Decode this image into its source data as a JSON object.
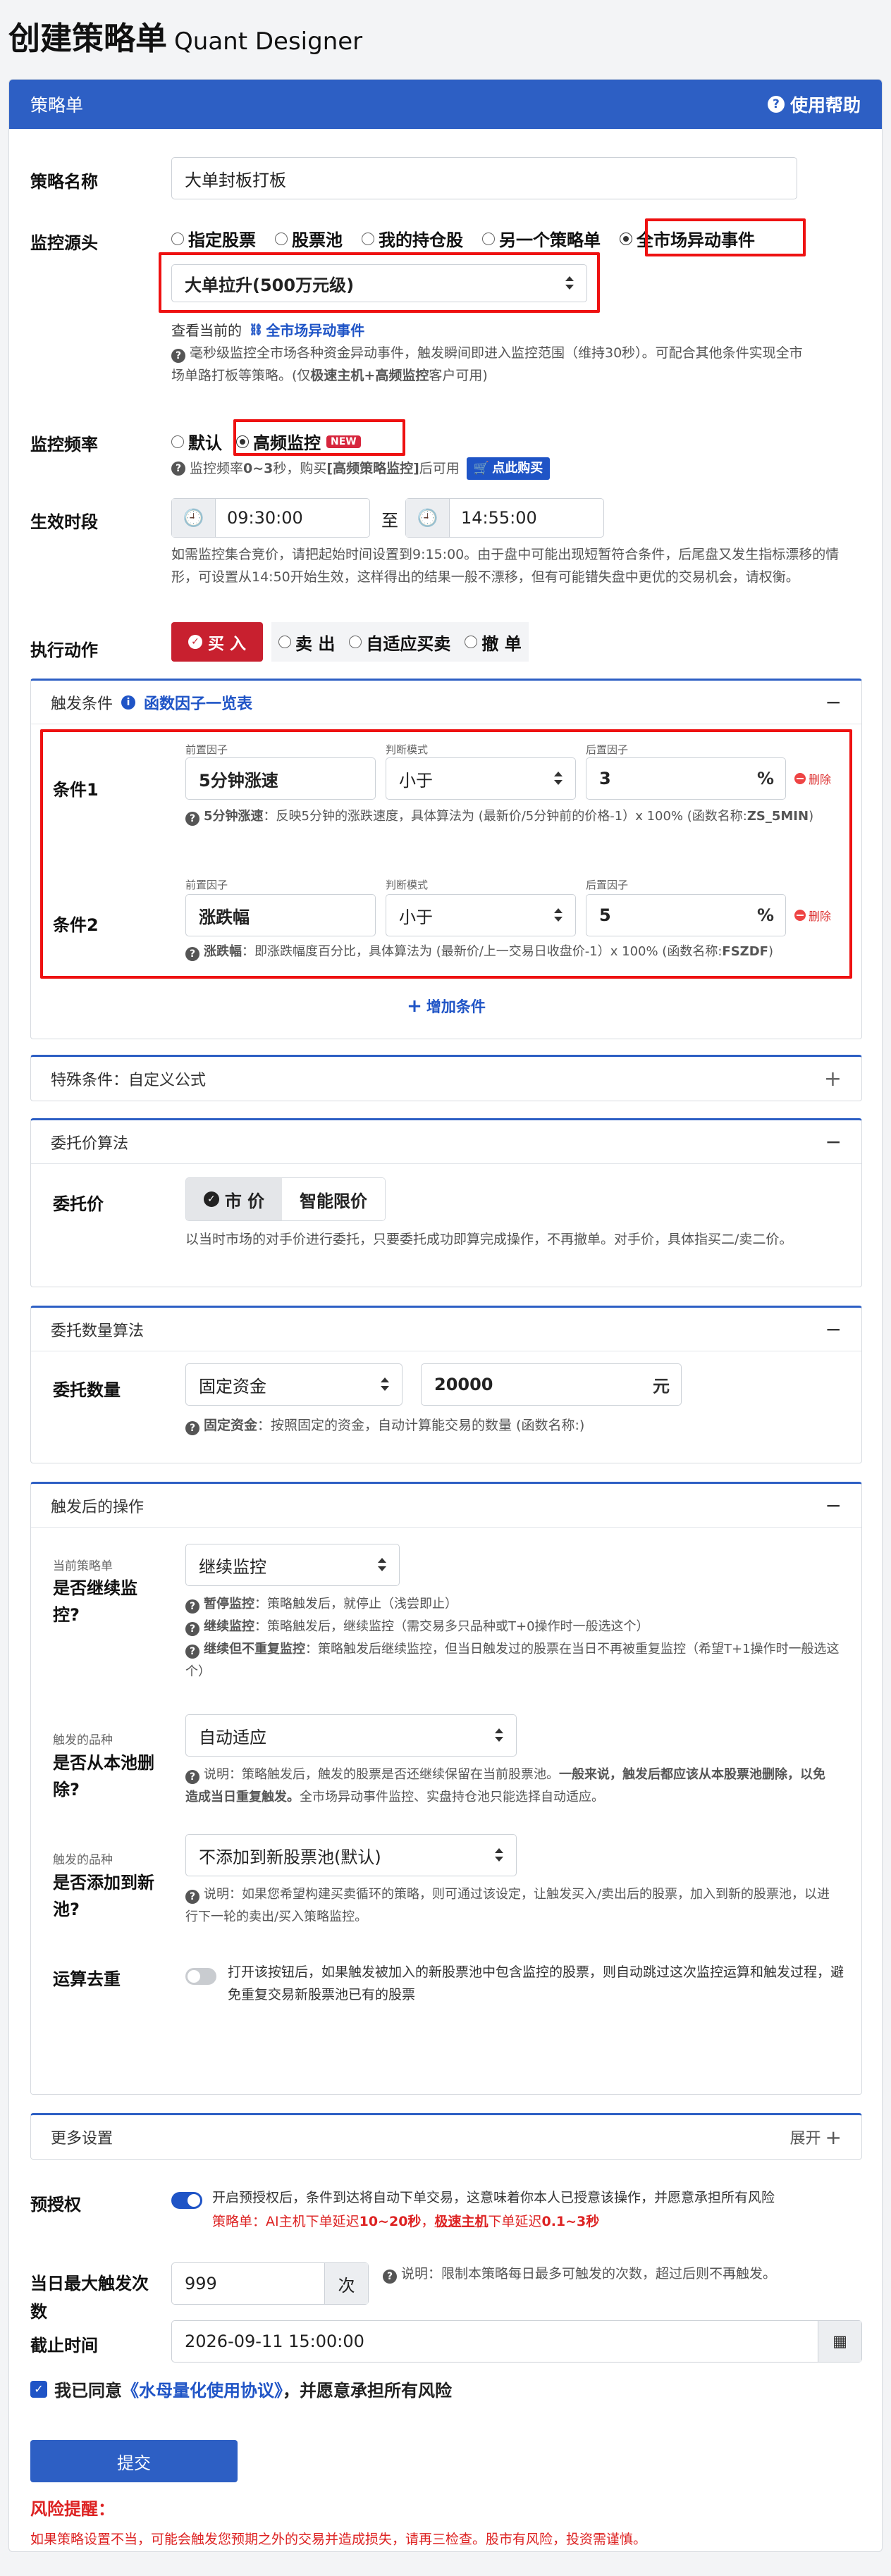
{
  "page": {
    "title": "创建策略单",
    "subtitle": "Quant Designer"
  },
  "card": {
    "title": "策略单",
    "help": "使用帮助"
  },
  "name_field": {
    "label": "策略名称",
    "value": "大单封板打板"
  },
  "source": {
    "label": "监控源头",
    "options": [
      "指定股票",
      "股票池",
      "我的持仓股",
      "另一个策略单",
      "全市场异动事件"
    ],
    "selected": "全市场异动事件",
    "event_select": "大单拉升(500万元级)",
    "view_current": "查看当前的",
    "event_link": "全市场异动事件",
    "note1": "毫秒级监控全市场各种资金异动事件，触发瞬间即进入监控范围（维持30秒）。可配合其他条件实现全市",
    "note2": "场单路打板等策略。(仅",
    "note2_bold": "极速主机+高频监控",
    "note2_tail": "客户可用)"
  },
  "freq": {
    "label": "监控频率",
    "opt_default": "默认",
    "opt_high": "高频监控",
    "badge": "NEW",
    "note_a": "监控频率 ",
    "note_b": "0~3",
    "note_c": " 秒，购买",
    "note_d": "[高频策略监控]",
    "note_e": "后可用",
    "buy_btn": "点此购买"
  },
  "time": {
    "label": "生效时段",
    "start": "09:30:00",
    "sep": "至",
    "end": "14:55:00",
    "note": "如需监控集合竞价，请把起始时间设置到9:15:00。由于盘中可能出现短暂符合条件，后尾盘又发生指标漂移的情形，可设置从14:50开始生效，这样得出的结果一般不漂移，但有可能错失盘中更优的交易机会，请权衡。"
  },
  "action": {
    "label": "执行动作",
    "buy": "买 入",
    "sell": "卖 出",
    "adaptive": "自适应买卖",
    "cancel": "撤 单"
  },
  "trigger": {
    "title": "触发条件",
    "link": "函数因子一览表",
    "collapse": "−",
    "pre_label": "前置因子",
    "mode_label": "判断模式",
    "post_label": "后置因子",
    "conditions": [
      {
        "name": "条件1",
        "factor": "5分钟涨速",
        "mode": "小于",
        "value": "3",
        "unit": "%",
        "delete": "删除",
        "note_bold": "5分钟涨速",
        "note": "：反映5分钟的涨跌速度，具体算法为 (最新价/5分钟前的价格-1）x 100% (函数名称:",
        "note_code": "ZS_5MIN",
        "note_end": ")"
      },
      {
        "name": "条件2",
        "factor": "涨跌幅",
        "mode": "小于",
        "value": "5",
        "unit": "%",
        "delete": "删除",
        "note_bold": "涨跌幅",
        "note": "：即涨跌幅度百分比，具体算法为 (最新价/上一交易日收盘价-1）x 100% (函数名称:",
        "note_code": "FSZDF",
        "note_end": ")"
      }
    ],
    "add": "增加条件"
  },
  "special": {
    "title": "特殊条件：自定义公式",
    "expand": "+"
  },
  "price_algo": {
    "title": "委托价算法",
    "collapse": "−",
    "label": "委托价",
    "opt_market": "市 价",
    "opt_smart": "智能限价",
    "note": "以当时市场的对手价进行委托，只要委托成功即算完成操作，不再撤单。对手价，具体指买二/卖二价。"
  },
  "qty_algo": {
    "title": "委托数量算法",
    "collapse": "−",
    "label": "委托数量",
    "mode": "固定资金",
    "amount": "20000",
    "unit": "元",
    "note_bold": "固定资金",
    "note": "：按照固定的资金，自动计算能交易的数量 (函数名称:)"
  },
  "after": {
    "title": "触发后的操作",
    "collapse": "−",
    "continue": {
      "small": "当前策略单",
      "label": "是否继续监控?",
      "value": "继续监控",
      "n1b": "暂停监控",
      "n1": "：策略触发后，就停止（浅尝即止）",
      "n2b": "继续监控",
      "n2": "：策略触发后，继续监控（需交易多只品种或T+0操作时一般选这个）",
      "n3b": "继续但不重复监控",
      "n3": "：策略触发后继续监控，但当日触发过的股票在当日不再被重复监控（希望T+1操作时一般选这个）"
    },
    "remove": {
      "small": "触发的品种",
      "label": "是否从本池删除?",
      "value": "自动适应",
      "n_a": "说明：策略触发后，触发的股票是否还继续保留在当前股票池。",
      "n_b": "一般来说，触发后都应该从本股票池删除，以免造成当日重复触发。",
      "n_c": "全市场异动事件监控、实盘持仓池只能选择自动适应。"
    },
    "add": {
      "small": "触发的品种",
      "label": "是否添加到新池?",
      "value": "不添加到新股票池(默认)",
      "note": "说明：如果您希望构建买卖循环的策略，则可通过该设定，让触发买入/卖出后的股票，加入到新的股票池，以进行下一轮的卖出/买入策略监控。"
    },
    "dedup": {
      "label": "运算去重",
      "note": "打开该按钮后，如果触发被加入的新股票池中包含监控的股票，则自动跳过这次监控运算和触发过程，避免重复交易新股票池已有的股票"
    }
  },
  "more": {
    "title": "更多设置",
    "expand": "展开"
  },
  "preauth": {
    "label": "预授权",
    "note": "开启预授权后，条件到达将自动下单交易，这意味着你本人已授意该操作，并愿意承担所有风险",
    "line_a": "策略单：AI主机下单延迟",
    "line_b": "10~20秒",
    "line_c": "，",
    "line_d": "极速主机",
    "line_e": "下单延迟",
    "line_f": "0.1~3秒"
  },
  "daily_max": {
    "label": "当日最大触发次数",
    "value": "999",
    "unit": "次",
    "note": "说明：限制本策略每日最多可触发的次数，超过后则不再触发。"
  },
  "deadline": {
    "label": "截止时间",
    "value": "2026-09-11 15:00:00"
  },
  "agree": {
    "a": "我已同意",
    "b": "《水母量化使用协议》",
    "c": "，并愿意承担所有风险"
  },
  "submit": "提交",
  "risk": {
    "title": "风险提醒：",
    "text": "如果策略设置不当，可能会触发您预期之外的交易并造成损失，请再三检查。股市有风险，投资需谨慎。"
  },
  "colors": {
    "primary": "#2d5fc4",
    "buy": "#c8202f",
    "highlight": "#e11111"
  }
}
